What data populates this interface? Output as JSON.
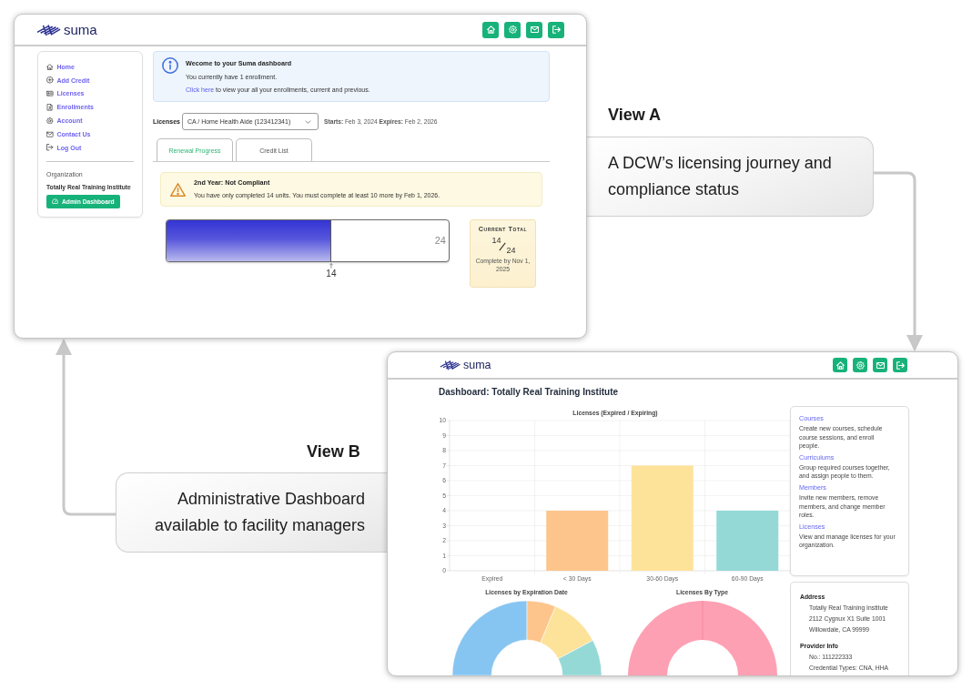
{
  "view_a": {
    "heading": "View A",
    "caption": "A DCW’s licensing journey and compliance status"
  },
  "window_a": {
    "header": {
      "brand": "suma",
      "toolbar": [
        {
          "kind": "home"
        },
        {
          "kind": "settings"
        },
        {
          "kind": "mail"
        },
        {
          "kind": "logout"
        }
      ]
    },
    "sidebar": {
      "items": [
        {
          "kind": "home",
          "label": "Home"
        },
        {
          "kind": "add",
          "label": "Add Credit"
        },
        {
          "kind": "license",
          "label": "Licenses"
        },
        {
          "kind": "document",
          "label": "Enrollments"
        },
        {
          "kind": "settings",
          "label": "Account"
        },
        {
          "kind": "mail",
          "label": "Contact Us"
        },
        {
          "kind": "logout",
          "label": "Log Out"
        }
      ],
      "organization_label": "Organization",
      "organization_name": "Totally Real Training Institute",
      "admin_button": "Admin Dashboard"
    },
    "notice": {
      "title": "Wecome to your Suma dashboard",
      "text": "You currently have 1 enrollment.",
      "link": "Click here",
      "link_text": "to view your all your enrollments, current and previous."
    },
    "license_select": {
      "label": "Licenses",
      "value": "CA / Home Health Aide (123412341)",
      "dates": "**Starts:** Feb 3, 2024 **Expires:** Feb 2, 2026"
    },
    "tabs": [
      {
        "label": "Renewal Progress",
        "selected": true
      },
      {
        "label": "Credit List",
        "selected": false
      }
    ],
    "alert": {
      "title": "2nd Year: Not Compliant",
      "message": "You have only completed 14 units. You must complete at least 10 more by Feb 1, 2026."
    },
    "progress": {
      "level": 0.583,
      "max": "24",
      "current": "14"
    },
    "total": {
      "title": "Current Total",
      "numerator": "14",
      "denominator": "24",
      "note": "Complete by Nov 1, 2025"
    }
  },
  "view_b": {
    "heading": "View B",
    "caption": "Administrative Dashboard available to facility managers"
  },
  "window_b": {
    "header": {
      "brand": "suma",
      "toolbar": [
        {
          "kind": "home"
        },
        {
          "kind": "settings"
        },
        {
          "kind": "mail"
        },
        {
          "kind": "logout"
        }
      ]
    },
    "title": "Dashboard: Totally Real Training Institute",
    "bar_chart": {
      "chart_data": {
        "type": "bar",
        "title": "Licenses (Expired / Expiring)",
        "categories": [
          "Expired",
          "< 30 Days",
          "30-60 Days",
          "60-90 Days"
        ],
        "values": [
          0,
          4,
          7,
          4
        ],
        "ylim": [
          0,
          10
        ],
        "yticks": [
          0,
          1,
          2,
          3,
          4,
          5,
          6,
          7,
          8,
          9,
          10
        ],
        "grid": true
      }
    },
    "donuts": [
      {
        "kind": "expiration",
        "title": "Licenses by Expiration Date"
      },
      {
        "kind": "type",
        "title": "Licenses By Type"
      }
    ],
    "actions": [
      {
        "title": "Courses",
        "description": "Create new courses, schedule course sessions, and enroll people."
      },
      {
        "title": "Curriculums",
        "description": "Group required courses together, and assign people to them."
      },
      {
        "title": "Members",
        "description": "Invite new members, remove members, and change member roles."
      },
      {
        "title": "Licenses",
        "description": "View and manage licenses for your organization."
      }
    ],
    "details": [
      {
        "heading": "Address",
        "lines": [
          "Totally Real Training Institute",
          "2112 Cygnux X1 Suite 1001",
          "Willowdale, CA 99999"
        ]
      },
      {
        "heading": "Provider Info",
        "lines": [
          "No.: 111222333",
          "Credential Types: CNA, HHA"
        ]
      }
    ]
  }
}
